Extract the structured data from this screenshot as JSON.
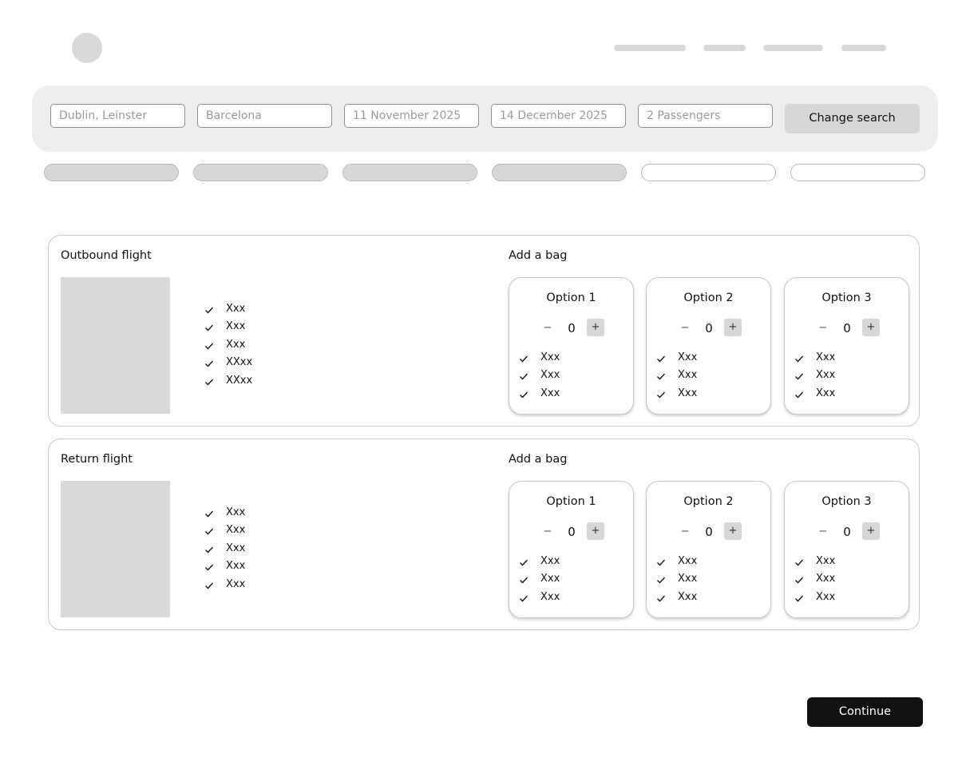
{
  "colors": {
    "placeholder_gray": "#d9d9d9",
    "button_gray": "#d9d6d6",
    "panel_bg": "#eeeeee",
    "primary_dark": "#111111"
  },
  "icons": {
    "logo": "circle-placeholder",
    "check": "check-icon"
  },
  "search": {
    "origin": "Dublin, Leinster",
    "destination": "Barcelona",
    "depart_date": "11 November 2025",
    "return_date": "14 December 2025",
    "passengers": "2 Passengers",
    "change_label": "Change search"
  },
  "outbound": {
    "title": "Outbound flight",
    "bag_title": "Add a bag",
    "features": [
      "Xxx",
      "Xxx",
      "Xxx",
      "XXxx",
      "XXxx"
    ],
    "options": [
      {
        "title": "Option 1",
        "count": "0",
        "minus": "−",
        "plus": "+",
        "features": [
          "Xxx",
          "Xxx",
          "Xxx"
        ]
      },
      {
        "title": "Option 2",
        "count": "0",
        "minus": "−",
        "plus": "+",
        "features": [
          "Xxx",
          "Xxx",
          "Xxx"
        ]
      },
      {
        "title": "Option 3",
        "count": "0",
        "minus": "−",
        "plus": "+",
        "features": [
          "Xxx",
          "Xxx",
          "Xxx"
        ]
      }
    ]
  },
  "return": {
    "title": "Return flight",
    "bag_title": "Add a bag",
    "features": [
      "Xxx",
      "Xxx",
      "Xxx",
      "Xxx",
      "Xxx"
    ],
    "options": [
      {
        "title": "Option 1",
        "count": "0",
        "minus": "−",
        "plus": "+",
        "features": [
          "Xxx",
          "Xxx",
          "Xxx"
        ]
      },
      {
        "title": "Option 2",
        "count": "0",
        "minus": "−",
        "plus": "+",
        "features": [
          "Xxx",
          "Xxx",
          "Xxx"
        ]
      },
      {
        "title": "Option 3",
        "count": "0",
        "minus": "−",
        "plus": "+",
        "features": [
          "Xxx",
          "Xxx",
          "Xxx"
        ]
      }
    ]
  },
  "continue_label": "Continue"
}
